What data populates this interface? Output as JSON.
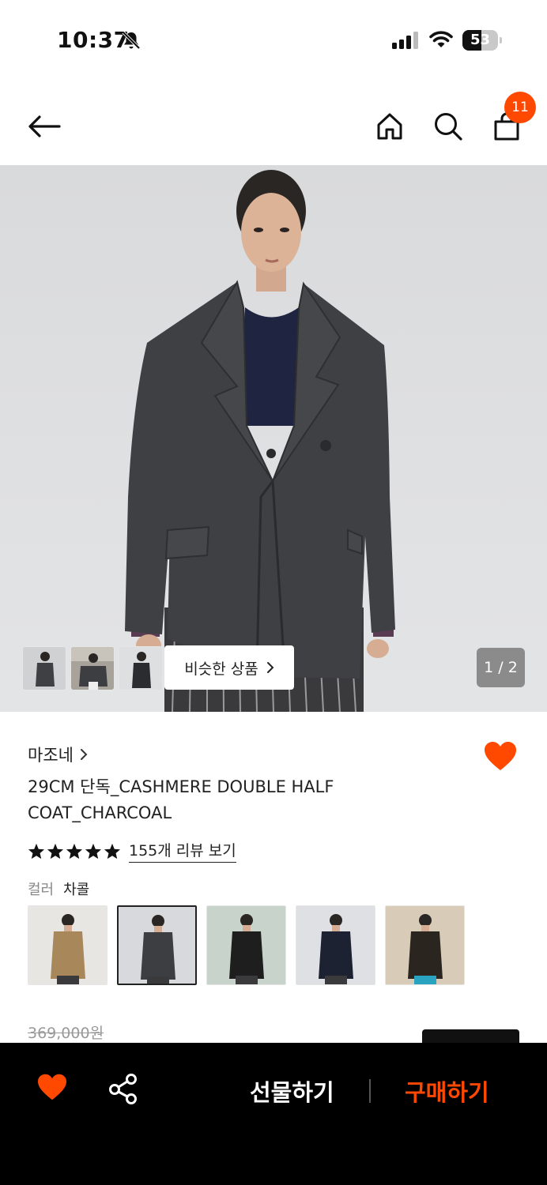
{
  "status_bar": {
    "time": "10:37",
    "battery": "53",
    "battery_level": 0.53
  },
  "header": {
    "cart_badge": "11",
    "icons": [
      "back-arrow-icon",
      "home-icon",
      "search-icon",
      "shopping-bag-icon"
    ]
  },
  "gallery": {
    "similar_label": "비슷한 상품",
    "pager": "1 / 2"
  },
  "product": {
    "brand": "마조네",
    "title": "29CM 단독_CASHMERE DOUBLE HALF COAT_CHARCOAL",
    "rating_stars": 5,
    "review_link": "155개 리뷰 보기",
    "color_label": "컬러",
    "color_value": "차콜",
    "swatches": [
      {
        "name": "camel",
        "coat": "#a8885a",
        "bg": "#e8e6e2",
        "selected": false
      },
      {
        "name": "charcoal",
        "coat": "#3d3e42",
        "bg": "#d8d9dc",
        "selected": true
      },
      {
        "name": "black",
        "coat": "#1e1e1e",
        "bg": "#c8d3cc",
        "selected": false
      },
      {
        "name": "navy",
        "coat": "#1d2233",
        "bg": "#dfe0e4",
        "selected": false
      },
      {
        "name": "dark-brown",
        "coat": "#2b2520",
        "bg": "#d8cbb7",
        "selected": false
      }
    ],
    "original_price": "369,000원"
  },
  "bottom_bar": {
    "gift_label": "선물하기",
    "buy_label": "구매하기"
  },
  "colors": {
    "accent": "#ff4800",
    "bottom_bar_bg": "#000000"
  }
}
